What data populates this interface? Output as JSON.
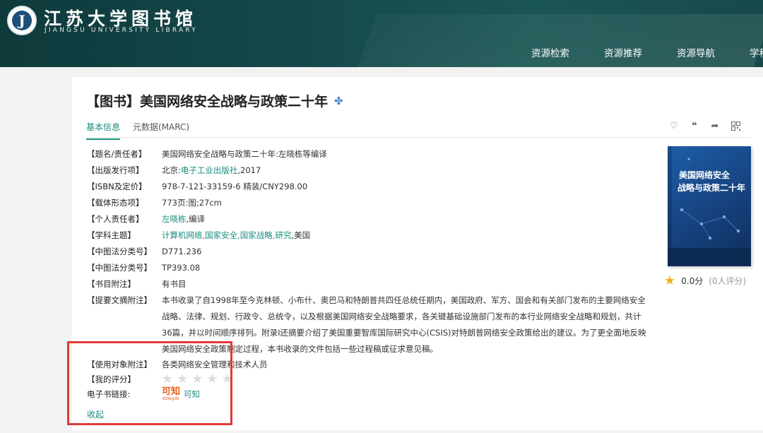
{
  "header": {
    "logo_mark": "J",
    "logo_cn": "江苏大学图书馆",
    "logo_en": "JIANGSU UNIVERSITY LIBRARY",
    "nav": [
      "资源检索",
      "资源推荐",
      "资源导航",
      "学科"
    ]
  },
  "book": {
    "title": "【图书】美国网络安全战略与政策二十年",
    "tabs": [
      "基本信息",
      "元数据(MARC)"
    ],
    "fields": {
      "title_resp_label": "【题名/责任者】",
      "title_resp": "美国网络安全战略与政策二十年:左晓栋等编译",
      "publisher_label": "【出版发行项】",
      "publisher_city": "北京:",
      "publisher_name": "电子工业出版社",
      "publisher_year": ",2017",
      "isbn_label": "【ISBN及定价】",
      "isbn": "978-7-121-33159-6 精装/CNY298.00",
      "form_label": "【载体形态项】",
      "form": "773页:图;27cm",
      "person_label": "【个人责任者】",
      "person_name": "左晓栋",
      "person_role": ",编译",
      "subject_label": "【学科主题】",
      "subject_links": "计算机网络,国家安全,国家战略,研究",
      "subject_tail": ",美国",
      "clc1_label": "【中图法分类号】",
      "clc1": "D771.236",
      "clc2_label": "【中图法分类号】",
      "clc2": "TP393.08",
      "bib_label": "【书目附注】",
      "bib": "有书目",
      "abstract_label": "【提要文摘附注】",
      "abstract": "本书收录了自1998年至今克林顿、小布什、奥巴马和特朗普共四任总统任期内，美国政府、军方、国会和有关部门发布的主要网络安全战略、法律、规划、行政令、总统令，以及根据美国网络安全战略要求，各关键基础设施部门发布的本行业网络安全战略和规划，共计36篇，并以时间顺序排列。附录I还摘要介绍了美国重要智库国际研究中心(CSIS)对特朗普网络安全政策给出的建议。为了更全面地反映美国网络安全政策制定过程，本书收录的文件包括一些过程稿或征求意见稿。",
      "audience_label": "【使用对象附注】",
      "audience": "各类网络安全管理和技术人员",
      "my_rating_label": "【我的评分】",
      "ebook_label": "电子书链接:",
      "ebook_logo_cn": "可知",
      "ebook_logo_en": "Kzlegde",
      "ebook_link": "可知"
    },
    "cover": {
      "line1": "美国网络安全",
      "line2": "战略与政策二十年"
    },
    "rating": {
      "score": "0.0分",
      "count": "(0人评分)"
    },
    "collapse": "收起"
  },
  "colors": {
    "accent": "#1a8c7f",
    "header": "#14494a",
    "highlight": "#e03a3a"
  }
}
